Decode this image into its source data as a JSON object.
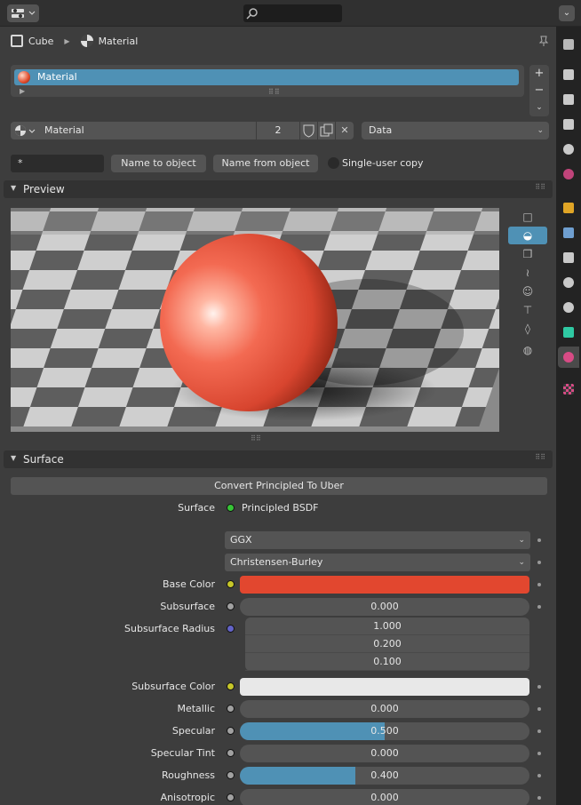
{
  "breadcrumb": {
    "object": "Cube",
    "material": "Material"
  },
  "slots": [
    {
      "label": "Material"
    }
  ],
  "material": {
    "name": "Material",
    "users": "2",
    "link": "Data"
  },
  "buttons": {
    "field_placeholder": "*",
    "name_to_object": "Name to object",
    "name_from_object": "Name from object",
    "single_user": "Single-user copy"
  },
  "panels": {
    "preview": "Preview",
    "surface": "Surface"
  },
  "surface": {
    "convert_label": "Convert Principled To Uber",
    "surface_label": "Surface",
    "surface_value": "Principled BSDF",
    "distribution": "GGX",
    "subsurface_method": "Christensen-Burley",
    "rows": [
      {
        "label": "Base Color",
        "kind": "color",
        "color": "#e2472f",
        "socket": "#c7c729"
      },
      {
        "label": "Subsurface",
        "kind": "value",
        "value": "0.000",
        "fill": 0,
        "socket": "#a1a1a1"
      },
      {
        "label": "Subsurface Radius",
        "kind": "vector",
        "values": [
          "1.000",
          "0.200",
          "0.100"
        ],
        "socket": "#6363c7"
      },
      {
        "label": "Subsurface Color",
        "kind": "color",
        "color": "#e8e8e8",
        "socket": "#c7c729"
      },
      {
        "label": "Metallic",
        "kind": "value",
        "value": "0.000",
        "fill": 0,
        "socket": "#a1a1a1"
      },
      {
        "label": "Specular",
        "kind": "value",
        "value": "0.500",
        "fill": 0.5,
        "socket": "#a1a1a1"
      },
      {
        "label": "Specular Tint",
        "kind": "value",
        "value": "0.000",
        "fill": 0,
        "socket": "#a1a1a1"
      },
      {
        "label": "Roughness",
        "kind": "value",
        "value": "0.400",
        "fill": 0.4,
        "socket": "#a1a1a1"
      },
      {
        "label": "Anisotropic",
        "kind": "value",
        "value": "0.000",
        "fill": 0,
        "socket": "#a1a1a1"
      }
    ]
  },
  "colors": {
    "accent": "#4f91b5",
    "base_color": "#e2472f"
  }
}
